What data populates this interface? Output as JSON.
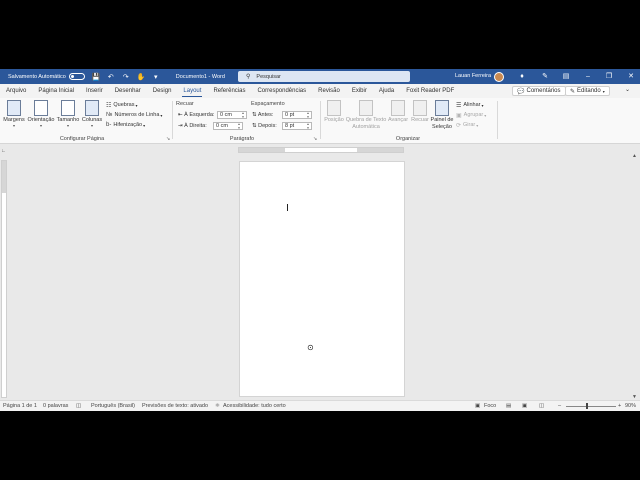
{
  "titlebar": {
    "autosave_label": "Salvamento Automático",
    "doc_title": "Documento1 - Word",
    "search_placeholder": "Pesquisar",
    "user_name": "Lauan Ferreira"
  },
  "tabs": [
    "Arquivo",
    "Página Inicial",
    "Inserir",
    "Desenhar",
    "Design",
    "Layout",
    "Referências",
    "Correspondências",
    "Revisão",
    "Exibir",
    "Ajuda",
    "Foxit Reader PDF"
  ],
  "active_tab": "Layout",
  "tab_actions": {
    "comments": "Comentários",
    "editing": "Editando"
  },
  "ribbon": {
    "page_setup": {
      "label": "Configurar Página",
      "margins": "Margens",
      "orientation": "Orientação",
      "size": "Tamanho",
      "columns": "Colunas",
      "breaks": "Quebras",
      "line_numbers": "Números de Linha",
      "hyphenation": "Hifenização"
    },
    "paragraph": {
      "label": "Parágrafo",
      "indent_title": "Recuar",
      "indent_left_label": "À Esquerda:",
      "indent_left_value": "0 cm",
      "indent_right_label": "À Direita:",
      "indent_right_value": "0 cm",
      "spacing_title": "Espaçamento",
      "before_label": "Antes:",
      "before_value": "0 pt",
      "after_label": "Depois:",
      "after_value": "8 pt"
    },
    "arrange": {
      "label": "Organizar",
      "position": "Posição",
      "wrap_text": "Quebra de Texto",
      "wrap_text_sub": "Automática",
      "bring_forward": "Avançar",
      "send_backward": "Recuar",
      "selection_pane": "Painel de",
      "selection_pane_sub": "Seleção",
      "align": "Alinhar",
      "group": "Agrupar",
      "rotate": "Girar"
    }
  },
  "status": {
    "page": "Página 1 de 1",
    "words": "0 palavras",
    "language": "Português (Brasil)",
    "predictions": "Previsões de texto: ativado",
    "accessibility": "Acessibilidade: tudo certo",
    "focus": "Foco",
    "zoom": "90%"
  },
  "icons": {
    "search": "search-icon",
    "save": "save-icon",
    "undo": "undo-icon",
    "redo": "redo-icon",
    "touch": "touch-mode-icon",
    "customize": "customize-quick-access-icon",
    "diamond": "rewards-icon",
    "pen": "pen-icon",
    "ribbon_display": "ribbon-display-icon",
    "minimize": "minimize-icon",
    "restore": "restore-icon",
    "close": "close-icon"
  },
  "colors": {
    "titlebar": "#2b579a",
    "accent": "#2b579a",
    "canvas": "#e9e9e9"
  }
}
